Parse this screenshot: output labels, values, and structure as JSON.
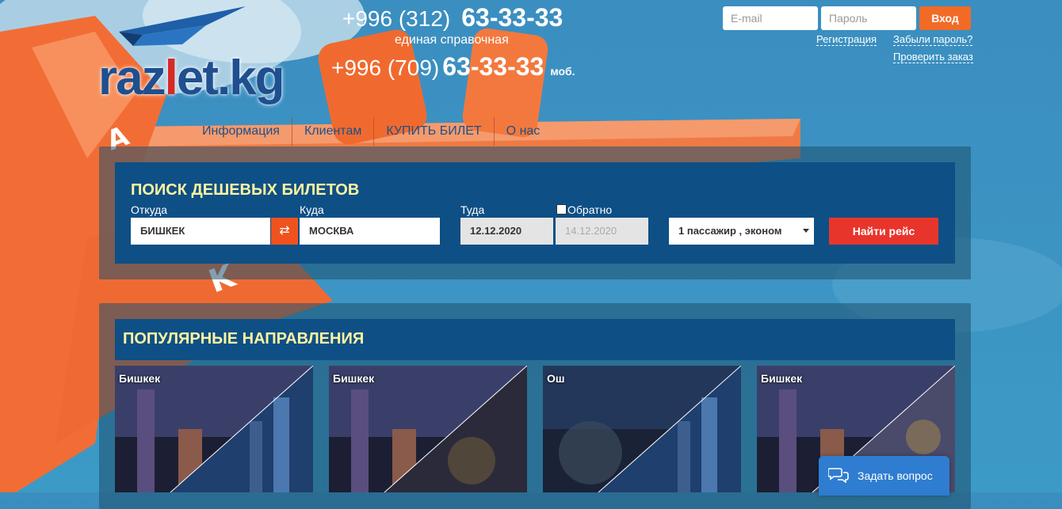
{
  "logo": {
    "text_main": "raz",
    "text_accent": "l",
    "text_rest": "et.kg"
  },
  "phones": {
    "line1_code": "+996 (312)",
    "line1_number": "63-33-33",
    "line1_caption": "единая справочная",
    "line2_code": "+996 (709)",
    "line2_number": "63-33-33",
    "line2_suffix": "моб."
  },
  "login": {
    "email_placeholder": "E-mail",
    "password_placeholder": "Пароль",
    "submit_label": "Вход",
    "register_link": "Регистрация",
    "forgot_link": "Забыли пароль?",
    "check_order_link": "Проверить заказ"
  },
  "nav": [
    {
      "label": "Информация"
    },
    {
      "label": "Клиентам"
    },
    {
      "label": "КУПИТЬ БИЛЕТ"
    },
    {
      "label": "О нас"
    }
  ],
  "search": {
    "title": "ПОИСК ДЕШЕВЫХ БИЛЕТОВ",
    "from_label": "Откуда",
    "from_value": "БИШКЕК",
    "swap_icon": "⇄",
    "to_label": "Куда",
    "to_value": "МОСКВА",
    "depart_label": "Туда",
    "depart_value": "12.12.2020",
    "return_label": "Обратно",
    "return_value": "14.12.2020",
    "passengers_value": "1 пассажир , эконом",
    "find_label": "Найти рейс"
  },
  "popular": {
    "title": "ПОПУЛЯРНЫЕ НАПРАВЛЕНИЯ",
    "cards": [
      {
        "city": "Бишкек"
      },
      {
        "city": "Бишкек"
      },
      {
        "city": "Ош"
      },
      {
        "city": "Бишкек"
      }
    ]
  },
  "chat": {
    "label": "Задать вопрос",
    "icon": "chat-bubbles-icon"
  },
  "colors": {
    "accent": "#f26b26",
    "panel": "#0e4f86",
    "title": "#fdf4a0",
    "find": "#e8352c"
  }
}
